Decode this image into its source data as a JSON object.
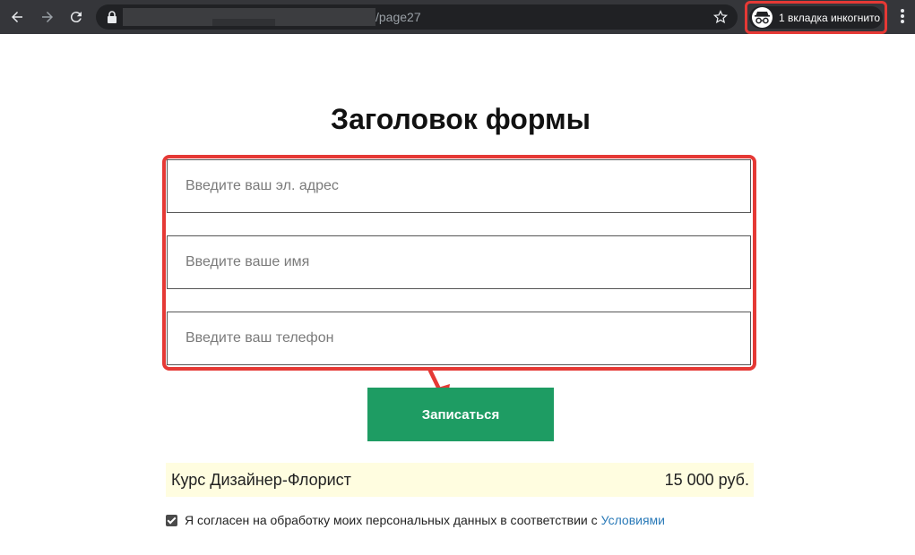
{
  "browser": {
    "url_path": "/page27",
    "incognito_label": "1 вкладка инкогнито"
  },
  "form": {
    "title": "Заголовок формы",
    "fields": {
      "email_placeholder": "Введите ваш эл. адрес",
      "name_placeholder": "Введите ваше имя",
      "phone_placeholder": "Введите ваш телефон"
    },
    "submit_label": "Записаться"
  },
  "product": {
    "name": "Курс Дизайнер-Флорист",
    "price": "15 000 руб."
  },
  "consent": {
    "checked": true,
    "text": "Я согласен на обработку моих персональных данных в соответствии с",
    "link_label": "Условиями"
  },
  "colors": {
    "toolbar": "#35363a",
    "highlight": "#e53935",
    "submit": "#1e9c63",
    "price_bg": "#fffde0",
    "link": "#2a7ab8"
  },
  "icons": [
    "back-arrow-icon",
    "forward-arrow-icon",
    "reload-icon",
    "lock-icon",
    "star-icon",
    "incognito-icon",
    "menu-dots-icon",
    "checkbox-icon",
    "arrow-icon"
  ]
}
